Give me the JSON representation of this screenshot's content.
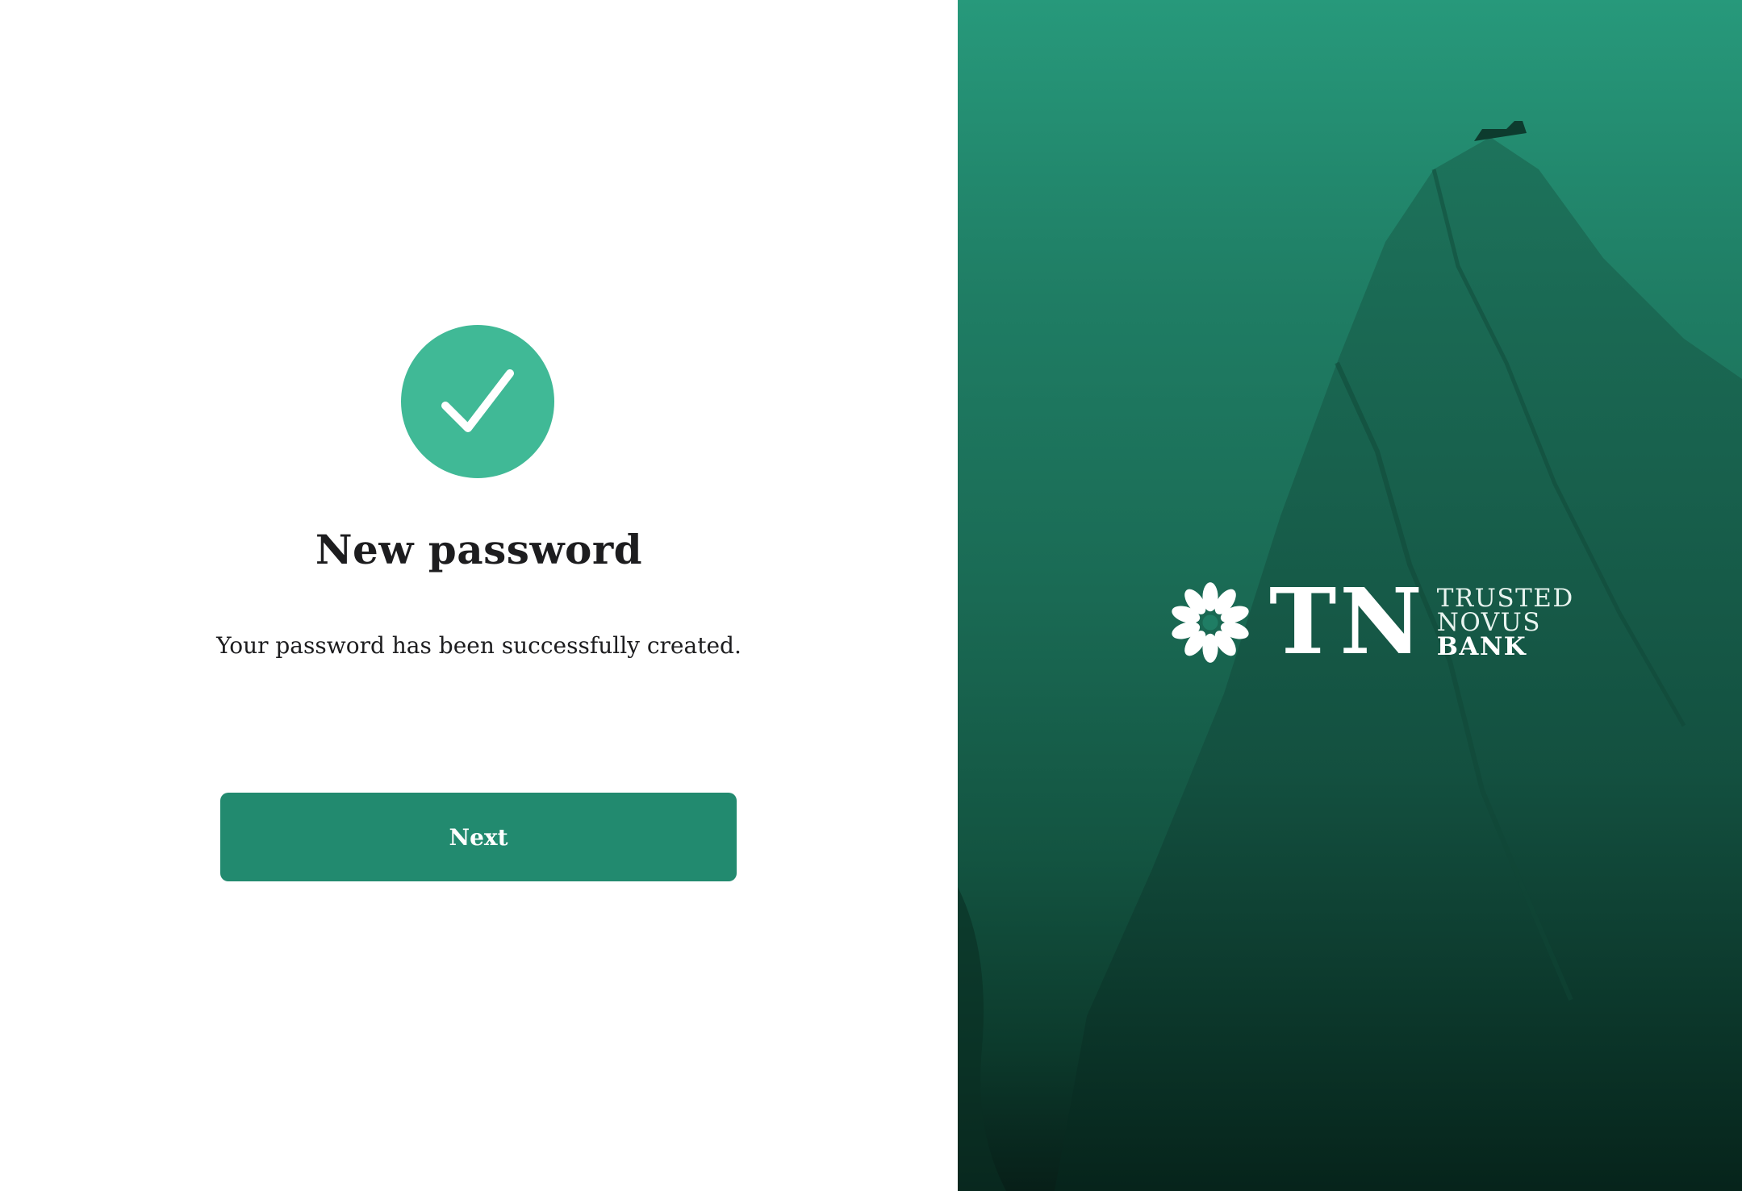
{
  "content": {
    "title": "New password",
    "message": "Your password has been successfully created.",
    "next_label": "Next"
  },
  "brand": {
    "monogram": "TN",
    "words": [
      "TRUSTED",
      "NOVUS",
      "BANK"
    ]
  },
  "icons": {
    "success": "check-icon",
    "logo": "flower-logo-icon"
  },
  "colors": {
    "success_badge": "#40b996",
    "button": "#228a6f",
    "panel_top": "#27997b",
    "panel_bottom": "#071f18",
    "text": "#1d1d1f"
  }
}
